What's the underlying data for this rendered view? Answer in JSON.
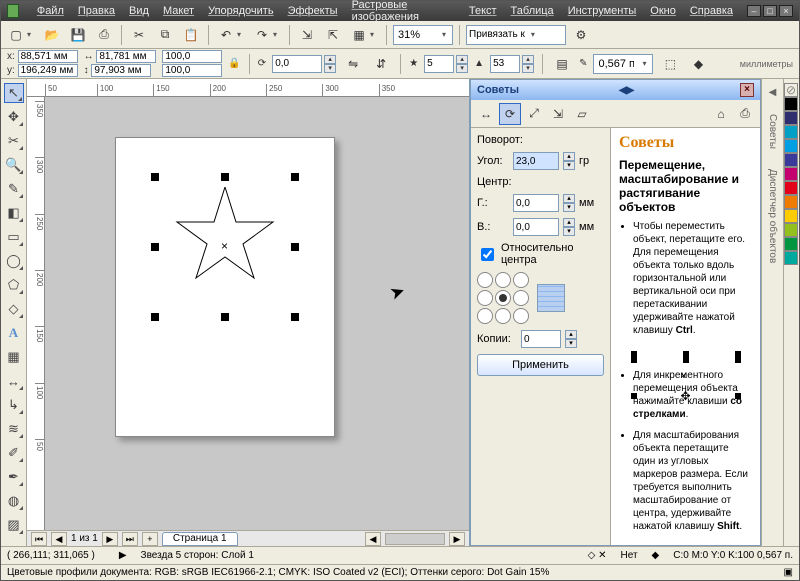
{
  "menu": {
    "file": "Файл",
    "edit": "Правка",
    "view": "Вид",
    "layout": "Макет",
    "arrange": "Упорядочить",
    "effects": "Эффекты",
    "bitmaps": "Растровые изображения",
    "text": "Текст",
    "table": "Таблица",
    "tools": "Инструменты",
    "window": "Окно",
    "help": "Справка"
  },
  "toolbar1": {
    "zoom": "31%",
    "bind": "Привязать к"
  },
  "props": {
    "x_label": "x:",
    "x": "88,571 мм",
    "y_label": "y:",
    "y": "196,249 мм",
    "w": "81,781 мм",
    "h": "97,903 мм",
    "sx": "100,0",
    "sy": "100,0",
    "rot": "0,0",
    "mm_label": "мм",
    "mm_word": "миллиметры",
    "points": "5",
    "sharp": "53",
    "outline": "0,567 п."
  },
  "ruler_h": [
    "50",
    "100",
    "150",
    "200",
    "250",
    "300",
    "350"
  ],
  "ruler_v": [
    "350",
    "300",
    "250",
    "200",
    "150",
    "100",
    "50"
  ],
  "pages": {
    "nav": "1 из 1",
    "tab": "Страница 1"
  },
  "docker": {
    "title": "Советы",
    "transform": {
      "section": "Поворот:",
      "angle_label": "Угол:",
      "angle": "23,0",
      "angle_unit": "гр",
      "center": "Центр:",
      "gx_label": "Г.:",
      "gx": "0,0",
      "gy_label": "В.:",
      "gy": "0,0",
      "unit": "мм",
      "relative": "Относительно центра",
      "copies_label": "Копии:",
      "copies": "0",
      "apply": "Применить"
    },
    "hints": {
      "h": "Советы",
      "sub": "Перемещение, масштабирование и растягивание объектов",
      "li1a": "Чтобы переместить объект, перетащите его. Для перемещения объекта только вдоль горизонтальной или вертикальной оси при перетаскивании удерживайте нажатой клавишу ",
      "li1b": "Ctrl",
      "li2a": "Для инкрементного перемещения объекта нажимайте клавиши ",
      "li2b": "со стрелками",
      "li3a": "Для масштабирования объекта перетащите один из угловых маркеров размера. Если требуется выполнить масштабирование от центра, удерживайте нажатой клавишу ",
      "li3b": "Shift"
    },
    "tabs": {
      "t1": "Советы",
      "t2": "Диспетчер объектов"
    }
  },
  "status": {
    "coords": "( 266,111; 311,065 )",
    "object": "Звезда  5 сторон: Слой 1",
    "fill": "Нет",
    "outline": "C:0 M:0 Y:0 K:100  0,567 п."
  },
  "status2": "Цветовые профили документа: RGB: sRGB IEC61966-2.1; CMYK: ISO Coated v2 (ECI); Оттенки серого: Dot Gain 15%",
  "palette": [
    "#ffffff",
    "#000000",
    "#00a0c6",
    "#0066b3",
    "#5a3b8e",
    "#c4006e",
    "#e2001a",
    "#ef7c00",
    "#ffcc00",
    "#93c01f",
    "#009640",
    "#00a99d",
    "#8a8a8a"
  ],
  "icons": {
    "star": "★",
    "lock": "🔒",
    "rot": "⟳",
    "flip": "⇋"
  }
}
